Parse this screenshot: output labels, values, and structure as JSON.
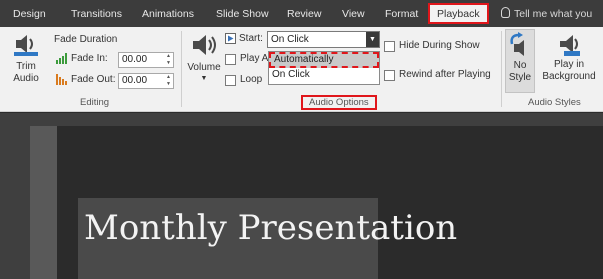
{
  "tabs": {
    "design": "Design",
    "transitions": "Transitions",
    "animations": "Animations",
    "slide_show": "Slide Show",
    "review": "Review",
    "view": "View",
    "format": "Format",
    "playback": "Playback",
    "tell_me": "Tell me what you"
  },
  "editing": {
    "trim_line1": "Trim",
    "trim_line2": "Audio",
    "fade_duration": "Fade Duration",
    "fade_in_label": "Fade In:",
    "fade_in_value": "00.00",
    "fade_out_label": "Fade Out:",
    "fade_out_value": "00.00",
    "group_label": "Editing"
  },
  "audio_options": {
    "volume_label": "Volume",
    "start_label": "Start:",
    "start_value": "On Click",
    "play_across_label": "Play A",
    "loop_label": "Loop",
    "menu_items": [
      "Automatically",
      "On Click"
    ],
    "hide_during_show": "Hide During Show",
    "rewind_after_playing": "Rewind after Playing",
    "group_label": "Audio Options"
  },
  "audio_styles": {
    "no_style_line1": "No",
    "no_style_line2": "Style",
    "play_bg_line1": "Play in",
    "play_bg_line2": "Background",
    "group_label": "Audio Styles"
  },
  "slide": {
    "title": "Monthly Presentation"
  },
  "colors": {
    "highlight_red": "#e0161b",
    "tabbar_bg": "#3c3c3c",
    "ribbon_bg": "#f1f1f1"
  }
}
